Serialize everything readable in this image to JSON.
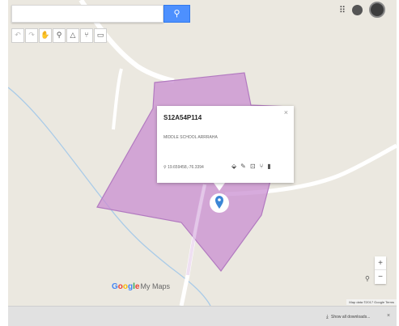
{
  "search": {
    "button_icon": "search-icon"
  },
  "toolbar": [
    {
      "glyph": "↶",
      "icon": "undo-icon",
      "enabled": false
    },
    {
      "glyph": "↷",
      "icon": "redo-icon",
      "enabled": false
    },
    {
      "glyph": "✋",
      "icon": "hand-pan-icon",
      "enabled": true
    },
    {
      "glyph": "⚲",
      "icon": "add-marker-icon",
      "enabled": true
    },
    {
      "glyph": "△",
      "icon": "draw-line-icon",
      "enabled": true
    },
    {
      "glyph": "⑂",
      "icon": "directions-icon",
      "enabled": true
    },
    {
      "glyph": "▭",
      "icon": "measure-ruler-icon",
      "enabled": true
    }
  ],
  "header": {
    "apps_glyph": "⠿",
    "profile_icon": "avatar"
  },
  "infowindow": {
    "title": "S12A54P114",
    "description": "MIDDLE SCHOOL ARRRAHA",
    "coordinates_prefix": "⚲",
    "coordinates": "19.659458,-76.3394",
    "close": "×",
    "actions": [
      {
        "glyph": "⬙",
        "icon": "style-paint-icon"
      },
      {
        "glyph": "✎",
        "icon": "edit-pencil-icon"
      },
      {
        "glyph": "⊡",
        "icon": "add-photo-icon"
      },
      {
        "glyph": "⑂",
        "icon": "directions-icon"
      },
      {
        "glyph": "▮",
        "icon": "delete-trash-icon"
      }
    ]
  },
  "zoom": {
    "in": "+",
    "out": "−"
  },
  "locate": "⚲",
  "logo": {
    "letters": [
      "G",
      "o",
      "o",
      "g",
      "l",
      "e"
    ],
    "suffix": "My Maps"
  },
  "attribution": "Map data ©2017 Google   Terms",
  "downloads": {
    "icon": "⤓",
    "label": "Show all downloads...",
    "close": "×"
  },
  "colors": {
    "map_background": "#ebe8e0",
    "polygon_fill": "#c98fd1",
    "polygon_stroke": "#b27ac0",
    "road": "#ffffff",
    "river": "#a9cbe8",
    "marker": "#3b86d6",
    "search_button": "#4d90fe"
  }
}
